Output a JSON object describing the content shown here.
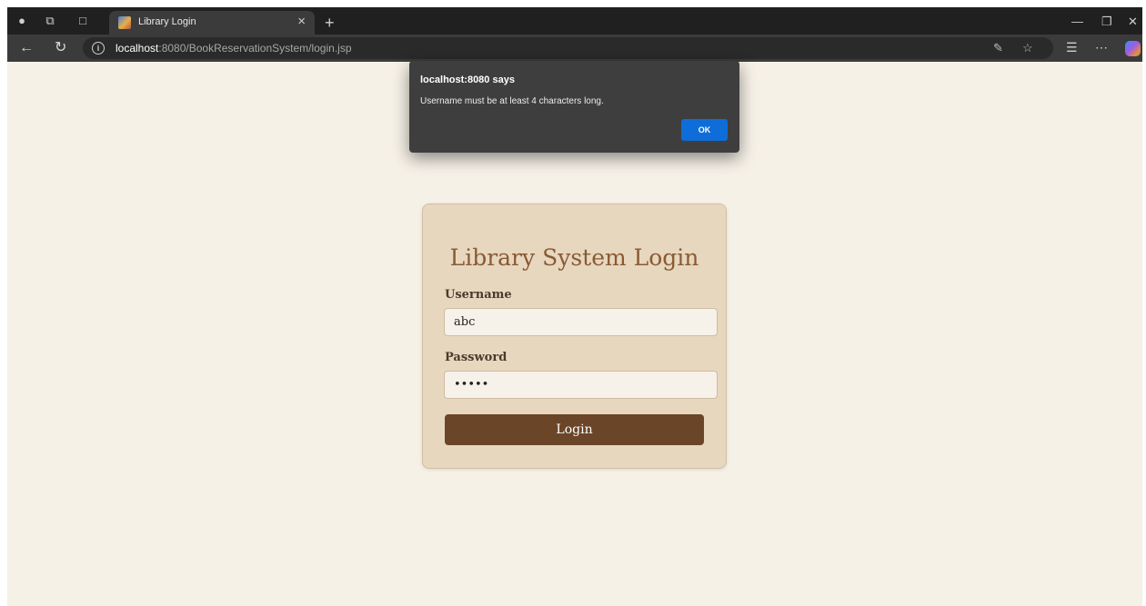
{
  "browser": {
    "tab_title": "Library Login",
    "url_host": "localhost",
    "url_rest": ":8080/BookReservationSystem/login.jsp"
  },
  "page": {
    "title": "Library System Login",
    "username_label": "Username",
    "username_value": "abc",
    "password_label": "Password",
    "password_value": "•••••",
    "login_label": "Login"
  },
  "dialog": {
    "title": "localhost:8080 says",
    "message": "Username must be at least 4 characters long.",
    "ok_label": "OK"
  },
  "colors": {
    "page_background": "#f6f1e7",
    "card_background": "#e7d7bf",
    "title_color": "#8a5a32",
    "button_color": "#6b4528",
    "dialog_ok": "#0e6dd8"
  }
}
